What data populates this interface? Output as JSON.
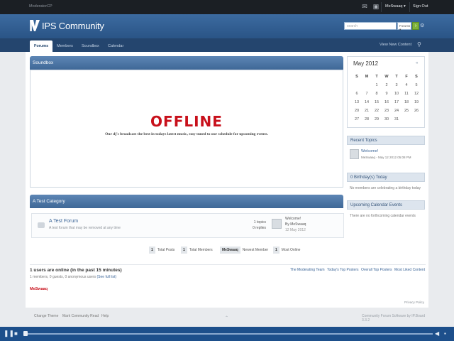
{
  "userbar": {
    "moderator_cp": "ModeratorCP",
    "username": "MeSwaaq ▾",
    "sign_out": "Sign Out"
  },
  "branding": {
    "logo_text": "IPS Community",
    "search_placeholder": "search",
    "search_scope": "Forums ▾",
    "search_go": "›",
    "advanced_icon": "gear-icon"
  },
  "nav": {
    "tabs": [
      {
        "label": "Forums",
        "active": true
      },
      {
        "label": "Members"
      },
      {
        "label": "Soundbox"
      },
      {
        "label": "Calendar"
      }
    ],
    "view_new_content": "View New Content"
  },
  "soundbox": {
    "title": "Soundbox",
    "offline": "OFFLINE",
    "message": "Our dj's broadcast the best in todays latest music, stay tuned to our schedule for upcoming events."
  },
  "category": {
    "title": "A Test Category",
    "forum": {
      "name": "A Test Forum",
      "description": "A test forum that may be removed at any time",
      "topics": "1 topics",
      "replies": "0 replies",
      "last_title": "Welcome!",
      "last_by": "By MeSwaaq",
      "last_date": "12 May 2012"
    }
  },
  "board_stats": {
    "total_posts_num": "1",
    "total_posts_label": "Total Posts",
    "total_members_num": "1",
    "total_members_label": "Total Members",
    "newest_member_name": "MeSwaaq",
    "newest_member_label": "Newest Member",
    "most_online_num": "1",
    "most_online_label": "Most Online"
  },
  "online": {
    "title": "1 users are online (in the past 15 minutes)",
    "summary": "1 members, 0 guests, 0 anonymous users",
    "full_list": "(See full list)",
    "users": "MeSwaaq",
    "links": [
      "The Moderating Team",
      "Today's Top Posters",
      "Overall Top Posters",
      "Most Liked Content"
    ],
    "privacy": "Privacy Policy"
  },
  "calendar": {
    "title": "May 2012",
    "toggle": "«",
    "weekdays": [
      "S",
      "M",
      "T",
      "W",
      "T",
      "F",
      "S"
    ],
    "weeks": [
      [
        "",
        "",
        "1",
        "2",
        "3",
        "4",
        "5"
      ],
      [
        "6",
        "7",
        "8",
        "9",
        "10",
        "11",
        "12"
      ],
      [
        "13",
        "14",
        "15",
        "16",
        "17",
        "18",
        "19"
      ],
      [
        "20",
        "21",
        "22",
        "23",
        "24",
        "25",
        "26"
      ],
      [
        "27",
        "28",
        "29",
        "30",
        "31",
        "",
        ""
      ]
    ]
  },
  "sidebar": {
    "recent_topics_title": "Recent Topics",
    "recent_topic_title": "Welcome!",
    "recent_topic_meta": "MeSwaaq - May 12 2012 05:08 PM",
    "birthdays_title": "0 Birthday(s) Today",
    "birthdays_text": "No members are celebrating a birthday today",
    "events_title": "Upcoming Calendar Events",
    "events_text": "There are no forthcoming calendar events"
  },
  "footer": {
    "change_theme": "Change Theme",
    "mark_read": "Mark Community Read",
    "help": "Help",
    "copyright": "Community Forum Software by IP.Board 3.3.2"
  },
  "colors": {
    "brand": "#2f5d91",
    "offline_red": "#c8101b",
    "search_go": "#7fb23a"
  }
}
